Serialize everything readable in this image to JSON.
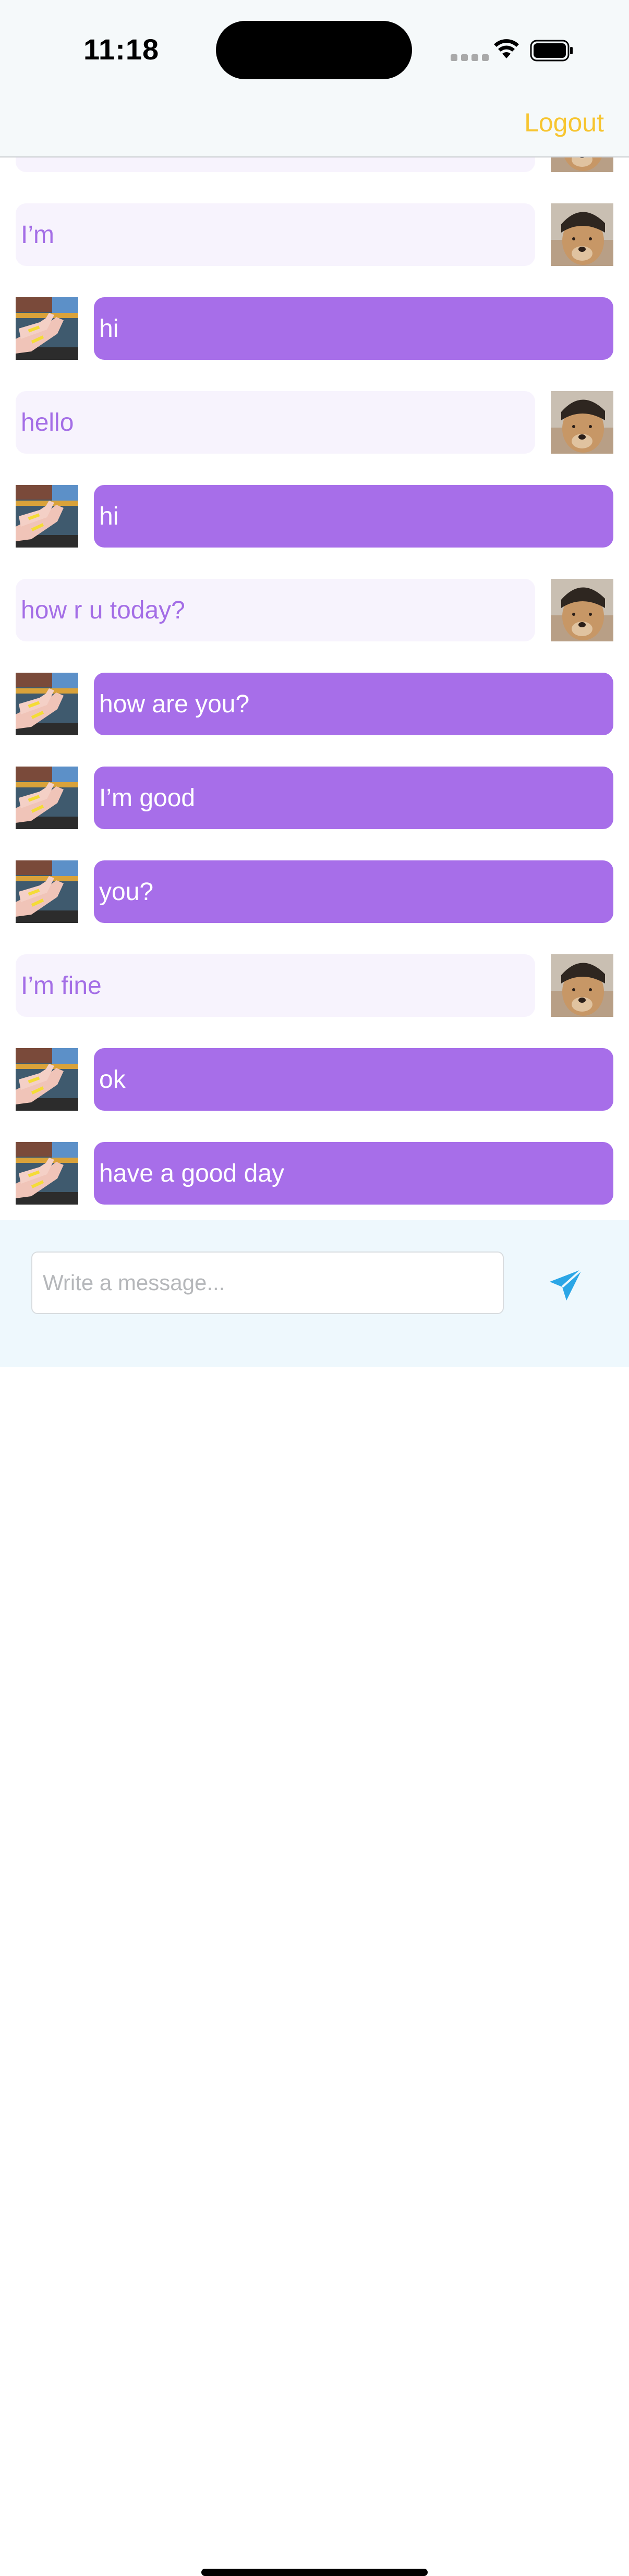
{
  "status_bar": {
    "time": "11:18"
  },
  "nav": {
    "logout_label": "Logout",
    "accent": "#f7c530"
  },
  "colors": {
    "sent_bubble": "#a76ee9",
    "received_bubble": "#f7f3fd",
    "received_text": "#a46ee6",
    "send_icon": "#2ba6e6"
  },
  "messages": [
    {
      "sender": "other",
      "text": ""
    },
    {
      "sender": "other",
      "text": "I’m"
    },
    {
      "sender": "me",
      "text": "hi"
    },
    {
      "sender": "other",
      "text": "hello"
    },
    {
      "sender": "me",
      "text": "hi"
    },
    {
      "sender": "other",
      "text": "how r u today?"
    },
    {
      "sender": "me",
      "text": "how are you?"
    },
    {
      "sender": "me",
      "text": "I’m good"
    },
    {
      "sender": "me",
      "text": "you?"
    },
    {
      "sender": "other",
      "text": "I’m fine"
    },
    {
      "sender": "me",
      "text": "ok"
    },
    {
      "sender": "me",
      "text": "have a good day"
    }
  ],
  "composer": {
    "placeholder": "Write a message...",
    "send_icon": "paper-plane-icon"
  }
}
